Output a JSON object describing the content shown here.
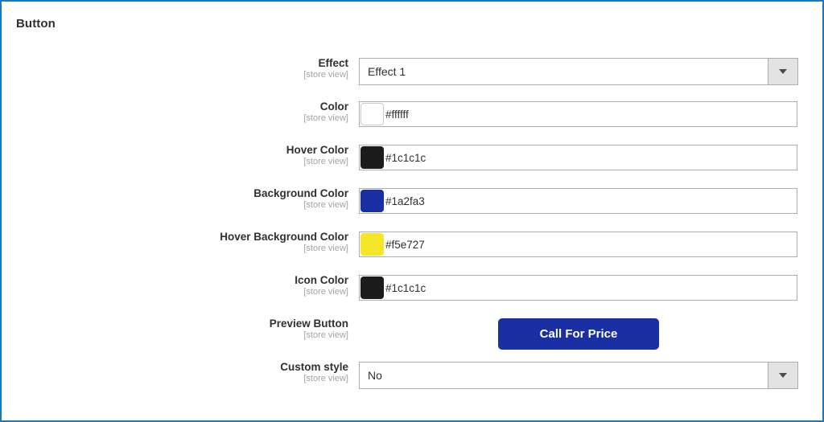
{
  "page": {
    "section_title": "Button",
    "frame_color": "#1979c3",
    "background": "#ffffff"
  },
  "scope_label": "[store view]",
  "icons": {
    "dropdown": "chevron-down-icon"
  },
  "fields": [
    {
      "id": "effect",
      "label": "Effect",
      "scope": "[store view]",
      "type": "select",
      "value": "Effect 1"
    },
    {
      "id": "color",
      "label": "Color",
      "scope": "[store view]",
      "type": "color",
      "value": "#ffffff",
      "swatch": "#ffffff",
      "swatch_bordered": true
    },
    {
      "id": "hover-color",
      "label": "Hover Color",
      "scope": "[store view]",
      "type": "color",
      "value": "#1c1c1c",
      "swatch": "#1c1c1c",
      "swatch_bordered": false
    },
    {
      "id": "background-color",
      "label": "Background Color",
      "scope": "[store view]",
      "type": "color",
      "value": "#1a2fa3",
      "swatch": "#1a2fa3",
      "swatch_bordered": false
    },
    {
      "id": "hover-background-color",
      "label": "Hover Background Color",
      "scope": "[store view]",
      "type": "color",
      "value": "#f5e727",
      "swatch": "#f5e727",
      "swatch_bordered": false
    },
    {
      "id": "icon-color",
      "label": "Icon Color",
      "scope": "[store view]",
      "type": "color",
      "value": "#1c1c1c",
      "swatch": "#1c1c1c",
      "swatch_bordered": false
    },
    {
      "id": "preview-button",
      "label": "Preview Button",
      "scope": "[store view]",
      "type": "button",
      "value": "Call For Price",
      "button_background": "#1a2fa3",
      "button_text_color": "#ffffff"
    },
    {
      "id": "custom-style",
      "label": "Custom style",
      "scope": "[store view]",
      "type": "select",
      "value": "No"
    }
  ]
}
